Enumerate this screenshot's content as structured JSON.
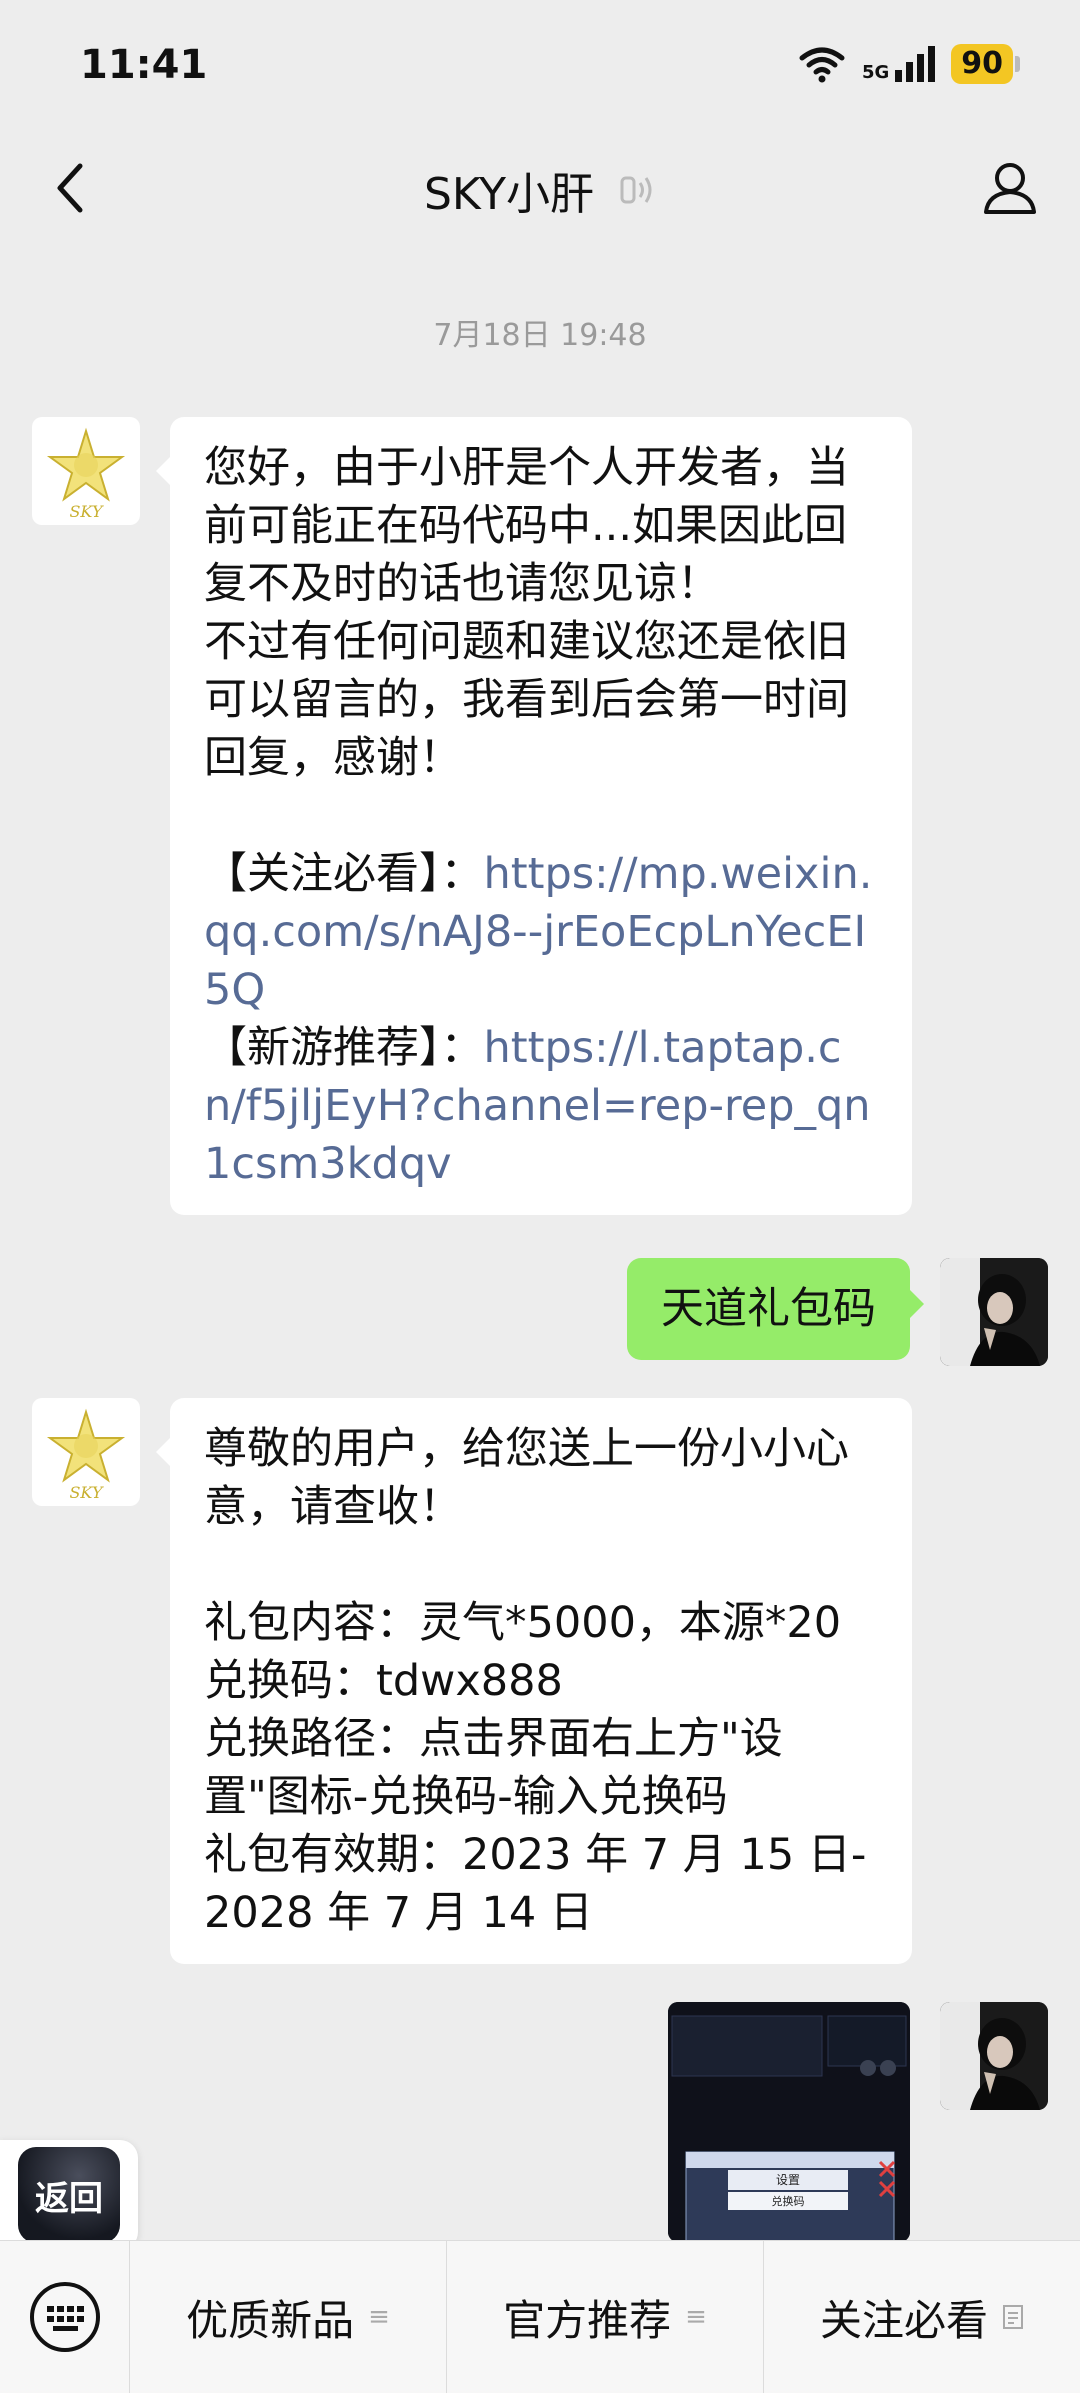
{
  "status_bar": {
    "time": "11:41",
    "network": "5G",
    "battery": "90"
  },
  "header": {
    "title": "SKY小肝"
  },
  "chat": {
    "timestamp": "7月18日 19:48",
    "msg1": {
      "text": "您好，由于小肝是个人开发者，当前可能正在码代码中...如果因此回复不及时的话也请您见谅！\n不过有任何问题和建议您还是依旧可以留言的，我看到后会第一时间回复，感谢！\n\n",
      "label1": "【关注必看】：",
      "link1": "https://mp.weixin.qq.com/s/nAJ8--jrEoEcpLnYecEI5Q",
      "label2": "\n【新游推荐】：",
      "link2": "https://l.taptap.cn/f5jljEyH?channel=rep-rep_qn1csm3kdqv"
    },
    "msg2": {
      "text": "天道礼包码"
    },
    "msg3": {
      "text": "尊敬的用户，给您送上一份小小心意，请查收！\n\n礼包内容：灵气*5000，本源*20\n兑换码：tdwx888\n兑换路径：点击界面右上方\"设置\"图标-兑换码-输入兑换码\n礼包有效期：2023 年 7 月 15 日-2028 年 7 月 14 日"
    },
    "image_labels": {
      "a": "设置",
      "b": "兑换码"
    }
  },
  "sky_logo_text": "SKY",
  "return_button": "返回",
  "menu": {
    "item1": "优质新品",
    "item2": "官方推荐",
    "item3": "关注必看"
  }
}
